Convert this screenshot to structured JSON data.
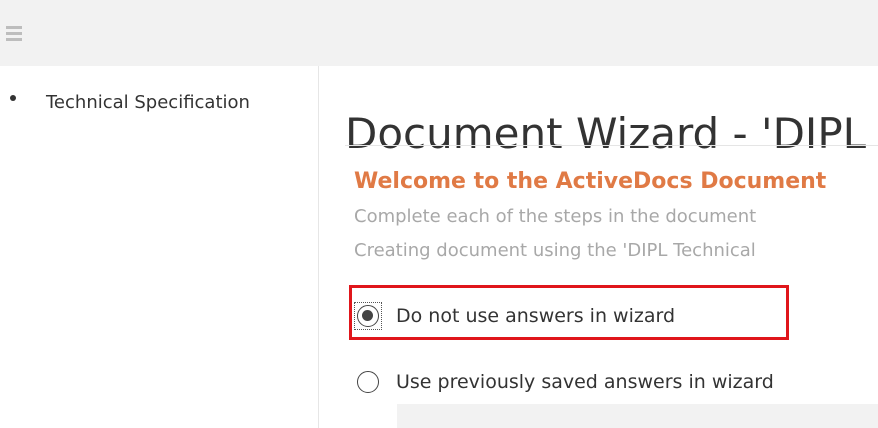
{
  "sidebar": {
    "items": [
      {
        "label": "Technical Specification"
      }
    ]
  },
  "main": {
    "title": "Document Wizard - 'DIPL",
    "welcome": "Welcome to the ActiveDocs Document",
    "instructions": [
      "Complete each of the steps in the document",
      "Creating document using the 'DIPL Technical"
    ],
    "answer_options": [
      {
        "label": "Do not use answers in wizard",
        "selected": true
      },
      {
        "label": "Use previously saved answers in wizard",
        "selected": false
      }
    ]
  },
  "colors": {
    "accent": "#e07a45",
    "highlight": "#e0161b",
    "muted_text": "#a8a8a8"
  },
  "icons": {
    "menu": "hamburger-menu-icon",
    "bullet": "bullet-icon"
  }
}
